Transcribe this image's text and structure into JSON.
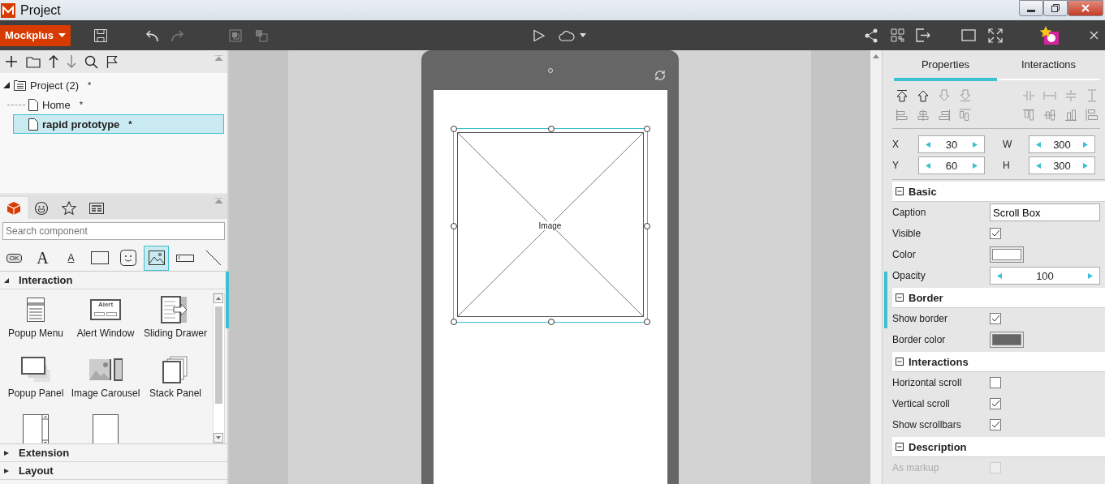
{
  "window": {
    "title": "Project"
  },
  "toolbar": {
    "brand": "Mockplus"
  },
  "tree": {
    "label": "Project (2)",
    "mark": "*",
    "expanded": true,
    "children": [
      {
        "label": "Home",
        "mark": "*",
        "selected": false
      },
      {
        "label": "rapid prototype",
        "mark": "*",
        "selected": true
      }
    ]
  },
  "component_tabs": [
    {
      "kind": "box",
      "selected": true
    },
    {
      "kind": "emoji",
      "selected": false
    },
    {
      "kind": "star",
      "selected": false
    },
    {
      "kind": "layout",
      "selected": false
    }
  ],
  "search": {
    "placeholder": "Search component"
  },
  "component_types": [
    {
      "kind": "button",
      "icon_text": "OK",
      "selected": false
    },
    {
      "kind": "text",
      "icon_text": "A",
      "selected": false
    },
    {
      "kind": "paragraph",
      "icon_text": "A",
      "selected": false
    },
    {
      "kind": "rectangle",
      "selected": false
    },
    {
      "kind": "emoji",
      "selected": false
    },
    {
      "kind": "image",
      "selected": true
    },
    {
      "kind": "input",
      "icon_text": "I",
      "selected": false
    },
    {
      "kind": "line",
      "selected": false
    }
  ],
  "library": [
    {
      "title": "Interaction",
      "expanded": true,
      "items": [
        {
          "kind": "popup-menu",
          "label": "Popup Menu"
        },
        {
          "kind": "alert",
          "label": "Alert Window",
          "icon_text": "Alert"
        },
        {
          "kind": "drawer",
          "label": "Sliding Drawer"
        },
        {
          "kind": "popup-panel",
          "label": "Popup Panel"
        },
        {
          "kind": "carousel",
          "label": "Image Carousel"
        },
        {
          "kind": "stack",
          "label": "Stack Panel"
        },
        {
          "kind": "scroll-box"
        },
        {
          "kind": "page"
        }
      ]
    },
    {
      "title": "Extension",
      "expanded": false
    },
    {
      "title": "Layout",
      "expanded": false
    }
  ],
  "canvas": {
    "image_label": "Image"
  },
  "panel_tabs": [
    {
      "label": "Properties",
      "selected": true
    },
    {
      "label": "Interactions",
      "selected": false
    }
  ],
  "geometry": [
    {
      "label": "X",
      "value": "30"
    },
    {
      "label": "W",
      "value": "300"
    },
    {
      "label": "Y",
      "value": "60"
    },
    {
      "label": "H",
      "value": "300"
    }
  ],
  "sections": [
    {
      "title": "Basic",
      "rows": [
        {
          "kind": "text",
          "label": "Caption",
          "value": "Scroll Box"
        },
        {
          "kind": "checkbox",
          "label": "Visible",
          "checked": true,
          "disabled": false
        },
        {
          "kind": "color",
          "label": "Color",
          "color": "#ffffff"
        },
        {
          "kind": "spinner",
          "label": "Opacity",
          "value": "100"
        }
      ]
    },
    {
      "title": "Border",
      "rows": [
        {
          "kind": "checkbox",
          "label": "Show border",
          "checked": true,
          "disabled": false
        },
        {
          "kind": "color",
          "label": "Border color",
          "color": "#666666"
        }
      ]
    },
    {
      "title": "Interactions",
      "rows": [
        {
          "kind": "checkbox",
          "label": "Horizontal scroll",
          "checked": false,
          "disabled": false
        },
        {
          "kind": "checkbox",
          "label": "Vertical scroll",
          "checked": true,
          "disabled": false
        },
        {
          "kind": "checkbox",
          "label": "Show scrollbars",
          "checked": true,
          "disabled": false
        }
      ]
    },
    {
      "title": "Description",
      "rows": [
        {
          "kind": "checkbox",
          "label": "As markup",
          "checked": false,
          "disabled": true
        }
      ]
    }
  ]
}
